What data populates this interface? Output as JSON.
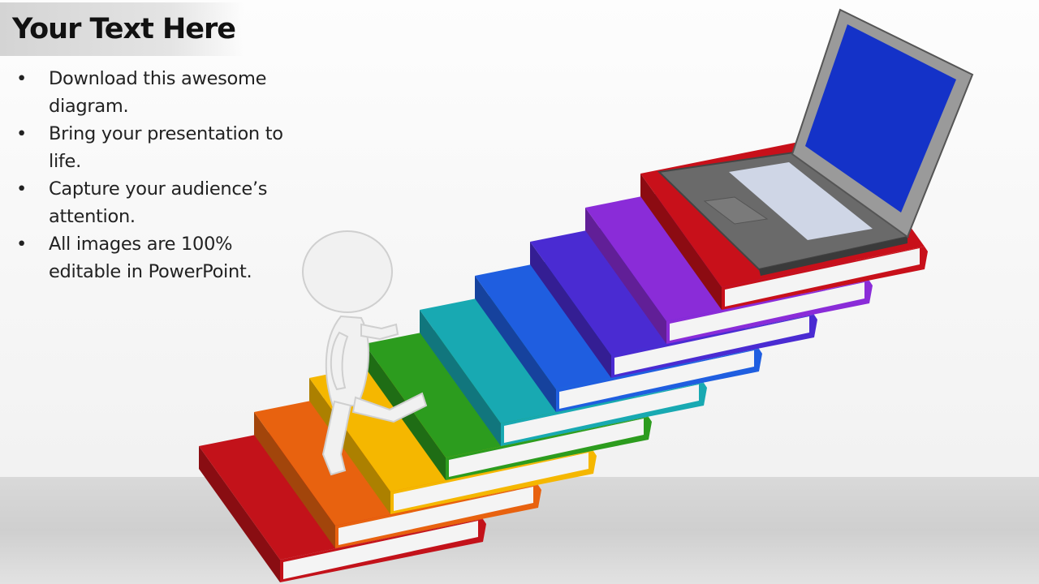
{
  "slide": {
    "title": "Your Text Here",
    "bullets": [
      "Download this awesome diagram.",
      "Bring your presentation to life.",
      "Capture your audience’s attention.",
      "All images are 100% editable in PowerPoint."
    ],
    "bullet_glyph": "•"
  },
  "illustration": {
    "book_colors": [
      "#c3121a",
      "#e8620f",
      "#f5b700",
      "#2c9c1e",
      "#18a9b2",
      "#1f5ee0",
      "#4a2bd2",
      "#8a2cd8",
      "#c8101a"
    ],
    "screen_color": "#1432c8"
  }
}
